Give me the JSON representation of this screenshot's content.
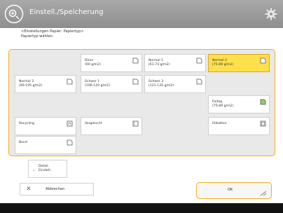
{
  "header": {
    "title": "Einstell./Speicherung"
  },
  "instructions": {
    "line1": "<Einstellungen Papier: Papiertyp>",
    "line2": "Papiertyp wählen."
  },
  "paper_types": [
    {
      "label": "Dünn\n(60 g/m2)",
      "selected": false
    },
    {
      "label": "Normal 1\n(61-74 g/m2)",
      "selected": false
    },
    {
      "label": "Normal 2\n(75-89 g/m2)",
      "selected": true
    },
    {
      "label": "Normal 3\n(90-105 g/m2)",
      "selected": false
    },
    {
      "label": "Schwer 1\n(106-120 g/m2)",
      "selected": false
    },
    {
      "label": "Schwer 3\n(121-135 g/m2)",
      "selected": false
    },
    {
      "label": "Farbig\n(75-89 g/m2)",
      "selected": false
    },
    {
      "label": "Recycling",
      "selected": false
    },
    {
      "label": "Vorgelocht",
      "selected": false
    },
    {
      "label": "Etiketten",
      "selected": false
    },
    {
      "label": "Bond",
      "selected": false
    }
  ],
  "detail_button": {
    "label": "Detail.\nEinstell."
  },
  "cancel_button": {
    "label": "Abbrechen"
  },
  "ok_button": {
    "label": "OK"
  },
  "colors": {
    "accent": "#f0ae1f",
    "selected": "#fde04a",
    "header": "#9a9a9a"
  }
}
